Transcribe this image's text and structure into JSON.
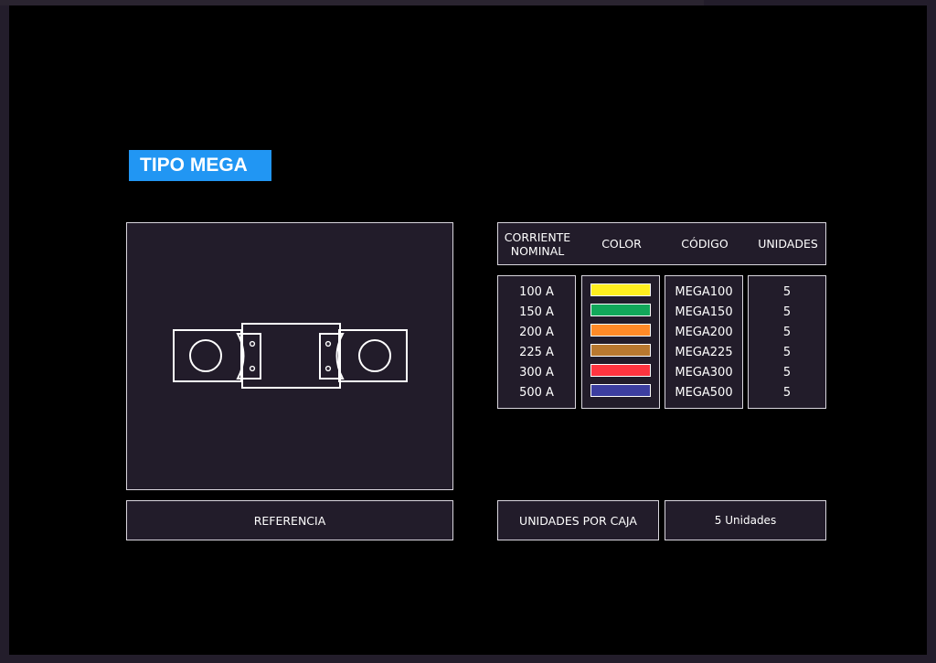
{
  "title": "TIPO MEGA",
  "reference_label": "REFERENCIA",
  "table": {
    "headers": {
      "corriente_line1": "CORRIENTE",
      "corriente_line2": "NOMINAL",
      "color": "COLOR",
      "codigo": "CÓDIGO",
      "unidades": "UNIDADES"
    },
    "rows": [
      {
        "corriente": "100 A",
        "color": "#ffef1f",
        "codigo": "MEGA100",
        "unidades": "5"
      },
      {
        "corriente": "150 A",
        "color": "#12a85a",
        "codigo": "MEGA150",
        "unidades": "5"
      },
      {
        "corriente": "200 A",
        "color": "#ff8a27",
        "codigo": "MEGA200",
        "unidades": "5"
      },
      {
        "corriente": "225 A",
        "color": "#b8782f",
        "codigo": "MEGA225",
        "unidades": "5"
      },
      {
        "corriente": "300 A",
        "color": "#ff3440",
        "codigo": "MEGA300",
        "unidades": "5"
      },
      {
        "corriente": "500 A",
        "color": "#3c3ea0",
        "codigo": "MEGA500",
        "unidades": "5"
      }
    ]
  },
  "units_per_box_label": "UNIDADES POR CAJA",
  "units_per_box_value": "5 Unidades",
  "colors": {
    "title_bg": "#2196f3",
    "sheet_bg": "#000000",
    "panel_bg": "#221c2a",
    "border": "#d9d6de"
  }
}
